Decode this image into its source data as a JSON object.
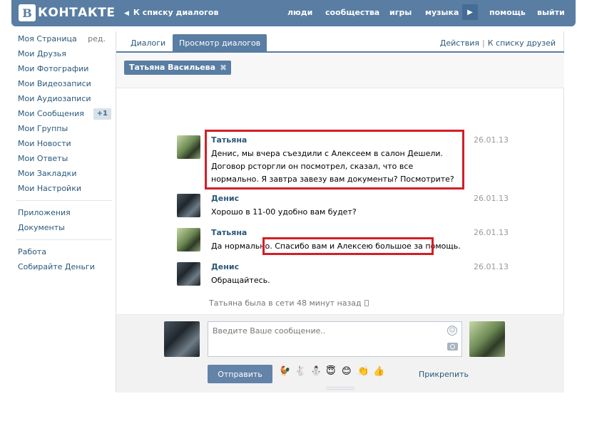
{
  "header": {
    "logo_letter": "В",
    "logo_text": "КОНТАКТЕ",
    "back_link": "К списку диалогов",
    "nav": [
      "люди",
      "сообщества",
      "игры",
      "музыка",
      "помощь",
      "выйти"
    ]
  },
  "sidebar": {
    "items": [
      {
        "label": "Моя Страница",
        "extra": "ред."
      },
      {
        "label": "Мои Друзья"
      },
      {
        "label": "Мои Фотографии"
      },
      {
        "label": "Мои Видеозаписи"
      },
      {
        "label": "Мои Аудиозаписи"
      },
      {
        "label": "Мои Сообщения",
        "badge": "+1"
      },
      {
        "label": "Мои Группы"
      },
      {
        "label": "Мои Новости"
      },
      {
        "label": "Мои Ответы"
      },
      {
        "label": "Мои Закладки"
      },
      {
        "label": "Мои Настройки"
      }
    ],
    "apps": [
      "Приложения",
      "Документы"
    ],
    "extra": [
      "Работа",
      "Собирайте Деньги"
    ]
  },
  "tabs": {
    "dialogs": "Диалоги",
    "view_dialogs": "Просмотр диалогов",
    "actions": "Действия",
    "separator": "|",
    "friends": "К списку друзей"
  },
  "recipient": {
    "name": "Татьяна Васильева",
    "remove": "✖"
  },
  "messages": [
    {
      "author": "Татьяна",
      "text": "Денис, мы вчера съездили с Алексеем в салон Дешели. Договор рсторгли он посмотрел, сказал, что все нормально. Я завтра завезу вам документы? Посмотрите?",
      "date": "26.01.13"
    },
    {
      "author": "Денис",
      "text": "Хорошо в 11-00 удобно вам будет?",
      "date": "26.01.13"
    },
    {
      "author": "Татьяна",
      "text": "Да нормально. Спасибо вам и Алексею большое за помощь.",
      "date": "26.01.13"
    },
    {
      "author": "Денис",
      "text": "Обращайтесь.",
      "date": "26.01.13"
    }
  ],
  "status": {
    "online": "Татьяна была в сети 48 минут назад"
  },
  "compose": {
    "placeholder": "Введите Ваше сообщение..",
    "send": "Отправить",
    "attach": "Прикрепить",
    "emojis": [
      "🐓",
      "🐇",
      "⛄",
      "😇",
      "😊",
      "👏",
      "👍"
    ]
  },
  "colors": {
    "header_bg": "#597da3",
    "link": "#2b587a",
    "highlight_box": "#d31e26"
  }
}
